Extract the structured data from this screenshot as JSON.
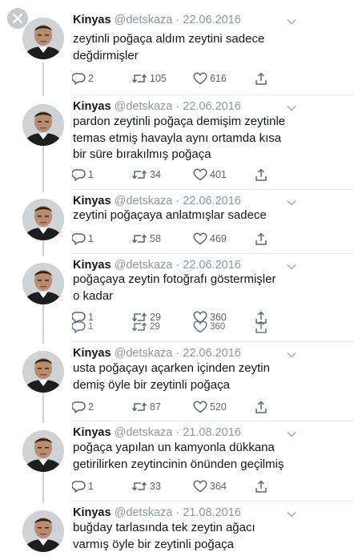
{
  "ui": {
    "close_icon": "close-icon",
    "reply_icon": "reply-icon",
    "retweet_icon": "retweet-icon",
    "like_icon": "heart-icon",
    "share_icon": "share-icon",
    "more_icon": "chevron-down-icon",
    "colors": {
      "text": "#14171a",
      "muted": "#8b98a5",
      "icon": "#5b6670",
      "divider": "#e6ecf0",
      "thread": "#ccd6dd"
    }
  },
  "tweets": [
    {
      "name": "Kinyas",
      "handle": "@detskaza",
      "dot": "·",
      "date": "22.06.2016",
      "lines": [
        "zeytinli poğaça aldım zeytini sadece",
        "değdirmişler"
      ],
      "reply": "2",
      "retweet": "105",
      "like": "616"
    },
    {
      "name": "Kinyas",
      "handle": "@detskaza",
      "dot": "·",
      "date": "22.06.2016",
      "lines": [
        "pardon zeytinli poğaça demişim zeytinle",
        "temas etmiş havayla aynı ortamda kısa",
        "bir süre bırakılmış poğaça"
      ],
      "reply": "1",
      "retweet": "34",
      "like": "401"
    },
    {
      "name": "Kinyas",
      "handle": "@detskaza",
      "dot": "·",
      "date": "22.06.2016",
      "lines": [
        "zeytini poğaçaya anlatmışlar sadece"
      ],
      "reply": "1",
      "retweet": "58",
      "like": "469"
    },
    {
      "name": "Kinyas",
      "handle": "@detskaza",
      "dot": "·",
      "date": "22.06.2016",
      "lines": [
        "poğaçaya zeytin fotoğrafı göstermişler",
        "o kadar"
      ],
      "reply": "1",
      "retweet": "29",
      "like": "360",
      "reply_2": "1",
      "retweet_2": "29",
      "like_2": "360"
    },
    {
      "name": "Kinyas",
      "handle": "@detskaza",
      "dot": "·",
      "date": "22.06.2016",
      "lines": [
        "usta poğaçayı açarken içinden zeytin",
        "demiş öyle bir zeytinli poğaça"
      ],
      "reply": "2",
      "retweet": "87",
      "like": "520"
    },
    {
      "name": "Kinyas",
      "handle": "@detskaza",
      "dot": "·",
      "date": "21.08.2016",
      "lines": [
        "poğaça yapılan un kamyonla dükkana",
        "getirilirken zeytincinin önünden geçilmiş"
      ],
      "reply": "1",
      "retweet": "33",
      "like": "364"
    },
    {
      "name": "Kinyas",
      "handle": "@detskaza",
      "dot": "·",
      "date": "21.08.2016",
      "lines": [
        "buğday tarlasında tek zeytin ağacı",
        "varmış öyle bir zeytinli poğaça"
      ]
    }
  ]
}
